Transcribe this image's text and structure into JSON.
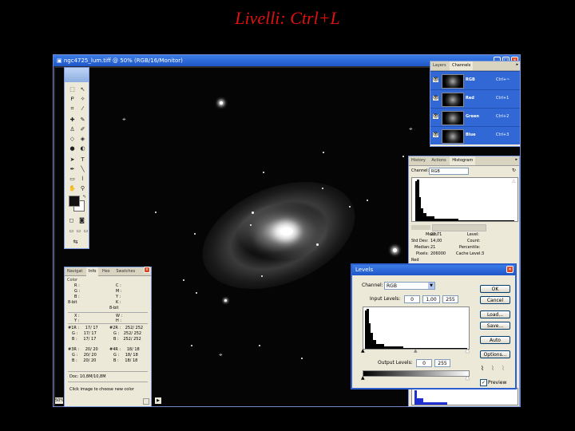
{
  "slide_title": "Livelli: Ctrl+L",
  "document": {
    "title": "ngc4725_lum.tiff @ 50% (RGB/16/Monitor)",
    "zoom": "50%",
    "doc_size": "Doc: 10,8M/10,8M"
  },
  "layers_panel": {
    "tabs": [
      "Layers",
      "Channels"
    ],
    "channels": [
      {
        "name": "RGB",
        "shortcut": "Ctrl+~"
      },
      {
        "name": "Red",
        "shortcut": "Ctrl+1"
      },
      {
        "name": "Green",
        "shortcut": "Ctrl+2"
      },
      {
        "name": "Blue",
        "shortcut": "Ctrl+3"
      }
    ]
  },
  "histogram_panel": {
    "tabs": [
      "History",
      "Actions",
      "Histogram"
    ],
    "channel_label": "Channel:",
    "channel_value": "RGB",
    "stats": {
      "mean_label": "Mean:",
      "mean": "23,71",
      "std_label": "Std Dev:",
      "std": "14,00",
      "median_label": "Median:",
      "median": "21",
      "pixels_label": "Pixels:",
      "pixels": "206000",
      "level_label": "Level:",
      "count_label": "Count:",
      "percentile_label": "Percentile:",
      "cache_label": "Cache Level:",
      "cache": "3"
    },
    "footer": "Red"
  },
  "info_panel": {
    "tabs": [
      "Navigat",
      "Info",
      "Hex",
      "Swatches",
      "Color"
    ],
    "rgb1": {
      "r": "R :",
      "g": "G :",
      "b": "B :",
      "bits": "8-bit"
    },
    "cmyk": {
      "c": "C :",
      "m": "M :",
      "y": "Y :",
      "k": "K :",
      "bits": "8-bit"
    },
    "xy": {
      "x": "X :",
      "y": "Y :"
    },
    "wh": {
      "w": "W :",
      "h": "H :"
    },
    "s1": {
      "r": "#1R :",
      "r_val": "17/  17",
      "g": "G :",
      "g_val": "17/  17",
      "b": "B :",
      "b_val": "17/  17"
    },
    "s2": {
      "r": "#2R :",
      "r_val": "252/ 252",
      "g": "G :",
      "g_val": "252/ 252",
      "b": "B :",
      "b_val": "252/ 252"
    },
    "s3": {
      "r": "#3R :",
      "r_val": "20/  20",
      "g": "G :",
      "g_val": "20/  20",
      "b": "B :",
      "b_val": "20/  20"
    },
    "s4": {
      "r": "#4R :",
      "r_val": "18/  18",
      "g": "G :",
      "g_val": "18/  18",
      "b": "B :",
      "b_val": "18/  18"
    },
    "doc": "Doc: 10,8M/10,8M",
    "hint": "Click image to choose new color"
  },
  "levels_dialog": {
    "title": "Levels",
    "channel_label": "Channel:",
    "channel_value": "RGB",
    "input_label": "Input Levels:",
    "input_black": "0",
    "input_gamma": "1,00",
    "input_white": "255",
    "output_label": "Output Levels:",
    "output_black": "0",
    "output_white": "255",
    "buttons": {
      "ok": "OK",
      "cancel": "Cancel",
      "load": "Load...",
      "save": "Save...",
      "auto": "Auto",
      "options": "Options..."
    },
    "preview_label": "Preview",
    "preview_checked": true
  }
}
